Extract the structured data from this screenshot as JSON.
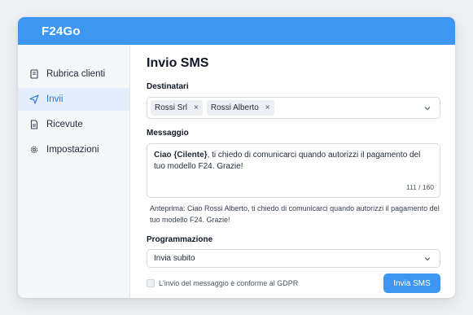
{
  "app": {
    "brand": "F24Go"
  },
  "sidebar": {
    "items": [
      {
        "label": "Rubrica clienti",
        "icon": "address-book-icon",
        "active": false
      },
      {
        "label": "Invii",
        "icon": "send-icon",
        "active": true
      },
      {
        "label": "Ricevute",
        "icon": "receipt-icon",
        "active": false
      },
      {
        "label": "Impostazioni",
        "icon": "gear-icon",
        "active": false
      }
    ]
  },
  "main": {
    "title": "Invio SMS",
    "recipients": {
      "label": "Destinatari",
      "chips": [
        "Rossi Srl",
        "Rossi Alberto"
      ],
      "remove_glyph": "×"
    },
    "message": {
      "label": "Messaggio",
      "placeholder_token": "Ciao {Cilente}",
      "text_rest": ", ti chiedo di comunicarci quando autorizzi il pagamento del tuo modello F24. Grazie!",
      "counter": "111 / 160"
    },
    "preview": "Anteprima: Ciao Rossi Alberto, ti chiedo di comunicarci quando autorizzi il pagamento del tuo modello F24. Grazie!",
    "schedule": {
      "label": "Programmazione",
      "selected": "Invia subito"
    },
    "gdpr": {
      "label": "L'invio del messaggio è conforme al GDPR",
      "checked": false
    },
    "send_button": "Invia SMS"
  },
  "colors": {
    "accent": "#3d97f0",
    "active_nav_bg": "#e4eefb",
    "active_nav_text": "#2478d6"
  }
}
